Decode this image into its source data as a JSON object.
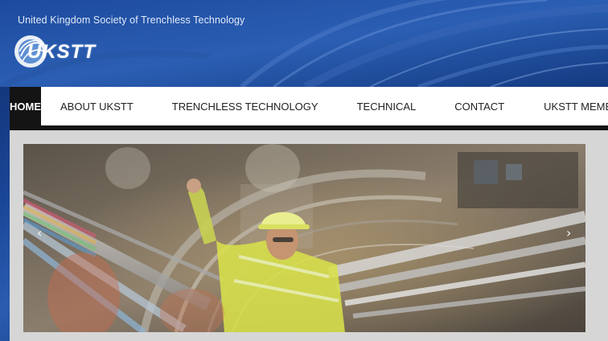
{
  "header": {
    "org_name": "United Kingdom Society of Trenchless Technology",
    "logo_text": "UKSTT"
  },
  "nav": {
    "items": [
      {
        "label": "HOME",
        "active": true
      },
      {
        "label": "ABOUT UKSTT",
        "active": false
      },
      {
        "label": "TRENCHLESS TECHNOLOGY",
        "active": false
      },
      {
        "label": "TECHNICAL",
        "active": false
      },
      {
        "label": "CONTACT",
        "active": false
      },
      {
        "label": "UKSTT MEMBER",
        "active": false
      }
    ]
  },
  "slider": {
    "image_icon": "tunnel-worker-photo",
    "prev_arrow": "‹",
    "next_arrow": "›"
  },
  "colors": {
    "header_blue": "#1a4596",
    "nav_active_bg": "#141414",
    "content_bg": "#d6d6d6",
    "vest_yellow": "#d7e04a"
  }
}
